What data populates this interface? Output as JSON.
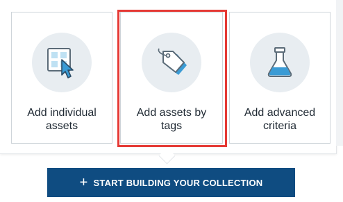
{
  "cards": [
    {
      "label": "Add individual assets",
      "icon": "individual-assets-icon"
    },
    {
      "label": "Add assets by tags",
      "icon": "tags-icon"
    },
    {
      "label": "Add advanced criteria",
      "icon": "flask-icon"
    }
  ],
  "cta": {
    "icon": "plus-icon",
    "plus_glyph": "+",
    "label": "START BUILDING YOUR COLLECTION"
  },
  "colors": {
    "accent_blue": "#3a9bd5",
    "button_bg": "#0f4c81",
    "highlight_red": "#e53935",
    "icon_circle_bg": "#e8edf1",
    "card_border": "#cfd5da"
  }
}
